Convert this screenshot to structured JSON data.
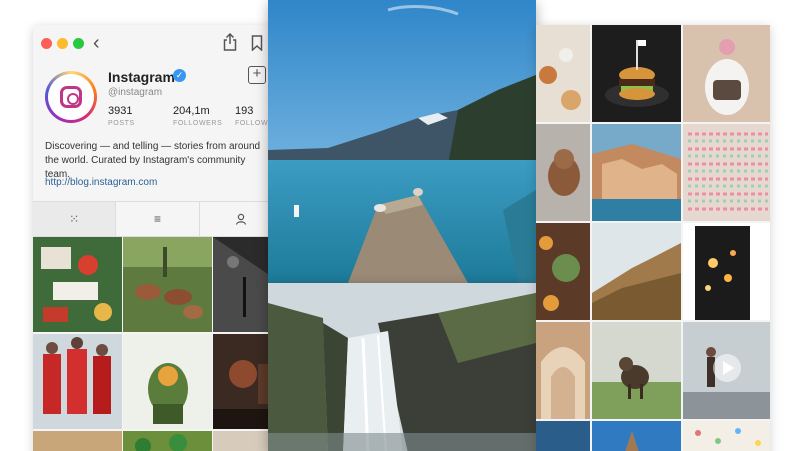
{
  "profile": {
    "username": "Instagram",
    "handle": "@instagram",
    "verified_mark": "✓",
    "stats": [
      {
        "value": "3931",
        "label": "POSTS"
      },
      {
        "value": "204,1m",
        "label": "FOLLOWERS"
      },
      {
        "value": "193",
        "label": "FOLLOW"
      }
    ],
    "bio": "Discovering — and telling — stories from around the world. Curated by Instagram's community team.",
    "link": "http://blog.instagram.com"
  },
  "window": {
    "traffic_lights": [
      "close",
      "minimize",
      "zoom"
    ],
    "back_glyph": "‹",
    "add_glyph": "+"
  },
  "tabs": [
    {
      "icon": "grid-icon",
      "glyph": "⁙"
    },
    {
      "icon": "list-icon",
      "glyph": "≡"
    },
    {
      "icon": "person-icon",
      "glyph": ""
    }
  ],
  "colors": {
    "accent": "#3897f0",
    "link": "#2d5f93",
    "close": "#fc5f57",
    "minimize": "#fdbc2e",
    "zoom": "#28c840"
  }
}
